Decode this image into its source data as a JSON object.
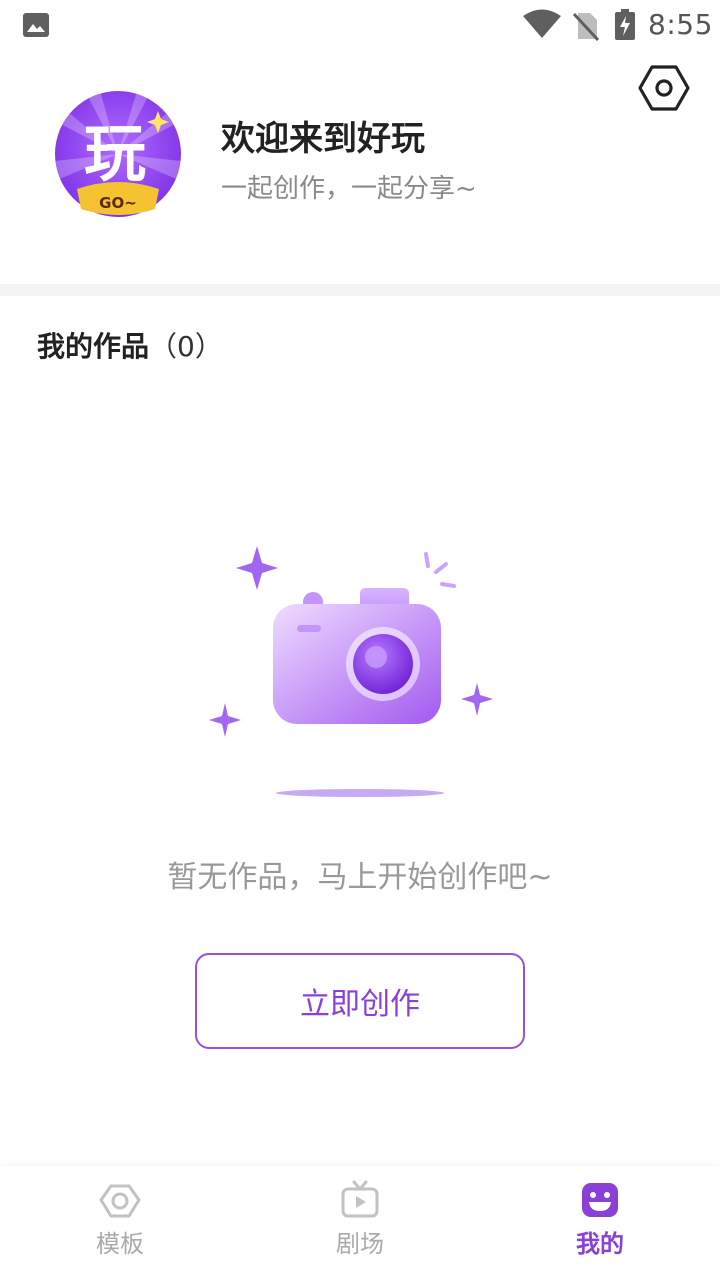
{
  "status_bar": {
    "time": "8:55",
    "icons": [
      "gallery-icon",
      "wifi-icon",
      "no-sim-icon",
      "battery-charging-icon"
    ]
  },
  "header": {
    "settings_icon": "hexagon-settings-icon",
    "avatar": {
      "glyph": "玩",
      "badge": "GO~"
    },
    "title": "欢迎来到好玩",
    "subtitle": "一起创作，一起分享~"
  },
  "works": {
    "title": "我的作品",
    "count": "（0）",
    "empty_text": "暂无作品，马上开始创作吧~",
    "create_button": "立即创作"
  },
  "bottom_nav": {
    "items": [
      {
        "label": "模板",
        "icon": "camera-template-icon",
        "active": false
      },
      {
        "label": "剧场",
        "icon": "tv-play-icon",
        "active": false
      },
      {
        "label": "我的",
        "icon": "smile-face-icon",
        "active": true
      }
    ]
  },
  "colors": {
    "accent": "#8a3fd6",
    "inactive": "#aaaaaa",
    "avatar_bg": "#8d3ef0",
    "avatar_badge": "#f5c232"
  }
}
